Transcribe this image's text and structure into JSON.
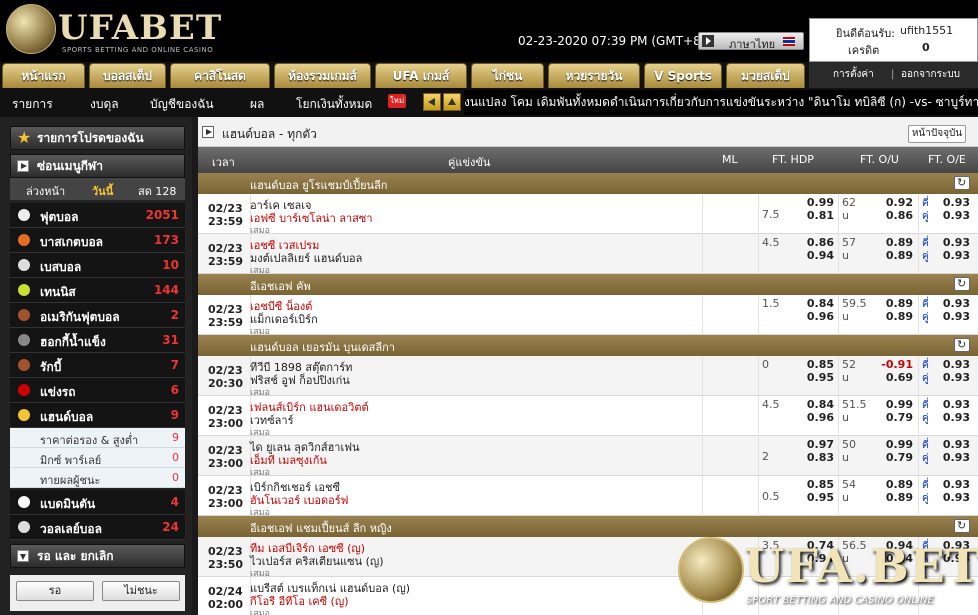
{
  "header": {
    "logo_text": "UFABET",
    "logo_sub": "SPORTS BETTING AND ONLINE CASINO",
    "datetime": "02-23-2020 07:39 PM (GMT+8)",
    "language": "ภาษาไทย",
    "welcome_label": "ยินดีต้อนรับ:",
    "username": "ufith1551",
    "credit_label": "เครดิต",
    "credit_value": "0"
  },
  "nav": {
    "tabs": [
      "หน้าแรก",
      "บอลสเต็ป",
      "คาสิโนสด",
      "ห้องรวมเกมส์",
      "UFA เกมส์",
      "ไก่ชน",
      "หวยรายวัน",
      "V Sports",
      "มวยสเต็ป"
    ],
    "settings": "การตั้งค่า",
    "logout": "ออกจากระบบ"
  },
  "subnav": {
    "items": [
      "รายการ",
      "งบดุล",
      "บัญชีของฉัน",
      "ผล",
      "โยกเงินทั้งหมด"
    ],
    "badge": "ใหม่",
    "ticker": "งนแปลง โคม เดิมพันทั้งหมดดำเนินการเกี่ยวกับการแข่งขันระหว่าง \"ดินาโม ทบิลิซี (ก) -vs- ซาบูร์ทาโร ทบิลิ"
  },
  "sidebar": {
    "favorites": "รายการโปรดของฉัน",
    "hide_menu": "ซ่อนเมนูกีฬา",
    "filters": [
      "ล่วงหน้า",
      "วันนี้",
      "สด 128"
    ],
    "sports": [
      {
        "label": "ฟุตบอล",
        "count": "2051",
        "color": "#eee"
      },
      {
        "label": "บาสเกตบอล",
        "count": "173",
        "color": "#e07020"
      },
      {
        "label": "เบสบอล",
        "count": "10",
        "color": "#ddd"
      },
      {
        "label": "เทนนิส",
        "count": "144",
        "color": "#c8e030"
      },
      {
        "label": "อเมริกันฟุตบอล",
        "count": "2",
        "color": "#a0522d"
      },
      {
        "label": "ฮอกกี้น้ำแข็ง",
        "count": "31",
        "color": "#888"
      },
      {
        "label": "รักบี้",
        "count": "7",
        "color": "#a0522d"
      },
      {
        "label": "แข่งรถ",
        "count": "6",
        "color": "#c00"
      },
      {
        "label": "แฮนด์บอล",
        "count": "9",
        "color": "#f4c430"
      }
    ],
    "handball_sub": [
      {
        "label": "ราคาต่อรอง & สูงต่ำ",
        "count": "9"
      },
      {
        "label": "มิกซ์ พาร์เลย์",
        "count": "0"
      },
      {
        "label": "ทายผลผู้ชนะ",
        "count": "0"
      }
    ],
    "sports_after": [
      {
        "label": "แบดมินตัน",
        "count": "4",
        "color": "#fff"
      },
      {
        "label": "วอลเลย์บอล",
        "count": "24",
        "color": "#ddd"
      }
    ],
    "bottom_head": "รอ และ ยกเลิก",
    "btn_wait": "รอ",
    "btn_cancel": "ไม่ชนะ"
  },
  "main": {
    "title": "แฮนด์บอล - ทุกตัว",
    "refresh": "หน้าปัจจุบัน",
    "columns": [
      "เวลา",
      "คู่แข่งขัน",
      "ML",
      "FT. HDP",
      "FT. O/U",
      "FT. O/E"
    ],
    "draw_label": "เสมอ",
    "ou_under": "u",
    "oe_odd": "คี่",
    "oe_even": "คู่",
    "leagues": [
      {
        "name": "แฮนด์บอล ยูโรแชมป์เปี้ยนลีก",
        "matches": [
          {
            "date": "02/23",
            "time": "23:59",
            "home": "อาร์เค เซลเจ",
            "away": "เอฟซี บาร์เซโลน่า ลาสซา",
            "fav": "away",
            "hcap": "7.5",
            "hdp_h": "0.99",
            "hdp_a": "0.81",
            "ou_line": "62",
            "ou_o": "0.92",
            "ou_u": "0.86",
            "oe_o": "0.93",
            "oe_e": "0.93",
            "hline": "a"
          },
          {
            "date": "02/23",
            "time": "23:59",
            "home": "เอชซี เวสเปรม",
            "away": "มงต์เปลลิเยร์ แฮนด์บอล",
            "fav": "home",
            "hcap": "4.5",
            "hdp_h": "0.86",
            "hdp_a": "0.94",
            "ou_line": "57",
            "ou_o": "0.89",
            "ou_u": "0.89",
            "oe_o": "0.93",
            "oe_e": "0.93",
            "hline": "h"
          }
        ]
      },
      {
        "name": "อีเอชเอฟ คัพ",
        "matches": [
          {
            "date": "02/23",
            "time": "23:59",
            "home": "เอชบีซี น็องต์",
            "away": "แม็กเดอร์เบิร์ก",
            "fav": "home",
            "hcap": "1.5",
            "hdp_h": "0.84",
            "hdp_a": "0.96",
            "ou_line": "59.5",
            "ou_o": "0.89",
            "ou_u": "0.89",
            "oe_o": "0.93",
            "oe_e": "0.93",
            "hline": "h"
          }
        ]
      },
      {
        "name": "แฮนด์บอล เยอรมัน บุนเดสลีกา",
        "matches": [
          {
            "date": "02/23",
            "time": "20:30",
            "home": "ทีวีบี 1898 สตุ๊ตการ์ท",
            "away": "ฟริสช์ อูฟ ก็อปปิงเก่น",
            "fav": "none",
            "hcap": "0",
            "hdp_h": "0.85",
            "hdp_a": "0.95",
            "ou_line": "52",
            "ou_o": "-0.91",
            "ou_u": "0.69",
            "oe_o": "0.93",
            "oe_e": "0.93",
            "hline": "h"
          },
          {
            "date": "02/23",
            "time": "23:00",
            "home": "เฟลนส์เบิร์ก แฮนเดอวิตต์",
            "away": "เวทซ์ลาร์",
            "fav": "home",
            "hcap": "4.5",
            "hdp_h": "0.84",
            "hdp_a": "0.96",
            "ou_line": "51.5",
            "ou_o": "0.99",
            "ou_u": "0.79",
            "oe_o": "0.93",
            "oe_e": "0.93",
            "hline": "h"
          },
          {
            "date": "02/23",
            "time": "23:00",
            "home": "ได ยูเลน ลุดวิกส์ฮาเฟน",
            "away": "เอ็มที เมลซุงเก้น",
            "fav": "away",
            "hcap": "2",
            "hdp_h": "0.97",
            "hdp_a": "0.83",
            "ou_line": "50",
            "ou_o": "0.99",
            "ou_u": "0.79",
            "oe_o": "0.93",
            "oe_e": "0.93",
            "hline": "a"
          },
          {
            "date": "02/23",
            "time": "23:00",
            "home": "เบิร์กกิชเชอร์ เอชซี",
            "away": "ฮันโนเวอร์ เบอดอร์ฟ",
            "fav": "away",
            "hcap": "0.5",
            "hdp_h": "0.85",
            "hdp_a": "0.95",
            "ou_line": "54",
            "ou_o": "0.89",
            "ou_u": "0.89",
            "oe_o": "0.93",
            "oe_e": "0.93",
            "hline": "a"
          }
        ]
      },
      {
        "name": "อีเอชเอฟ แชมเปี้ยนส์ ลีก หญิง",
        "matches": [
          {
            "date": "02/23",
            "time": "23:50",
            "home": "ทีม เอสบีเจิร์ก เอซซี (ญ)",
            "away": "ไวเปอร์ส คริสเตียนแซน (ญ)",
            "fav": "home",
            "hcap": "3.5",
            "hdp_h": "0.74",
            "hdp_a": "0.94",
            "ou_line": "56.5",
            "ou_o": "0.94",
            "ou_u": "0.84",
            "oe_o": "0.93",
            "oe_e": "0.93",
            "hline": "h"
          },
          {
            "date": "02/24",
            "time": "02:00",
            "home": "แบรีสต์ เบรแท็กเน่ แฮนด์บอล (ญ)",
            "away": "กีโอรี อีทีโอ เคซี (ญ)",
            "fav": "away",
            "hcap": "",
            "hdp_h": "",
            "hdp_a": "",
            "ou_line": "",
            "ou_o": "",
            "ou_u": "",
            "oe_o": "",
            "oe_e": "",
            "hline": "a"
          }
        ]
      }
    ]
  },
  "watermark": {
    "text": "UFA.BET",
    "sub": "SPORT BETTING AND CASINO ONLINE"
  }
}
